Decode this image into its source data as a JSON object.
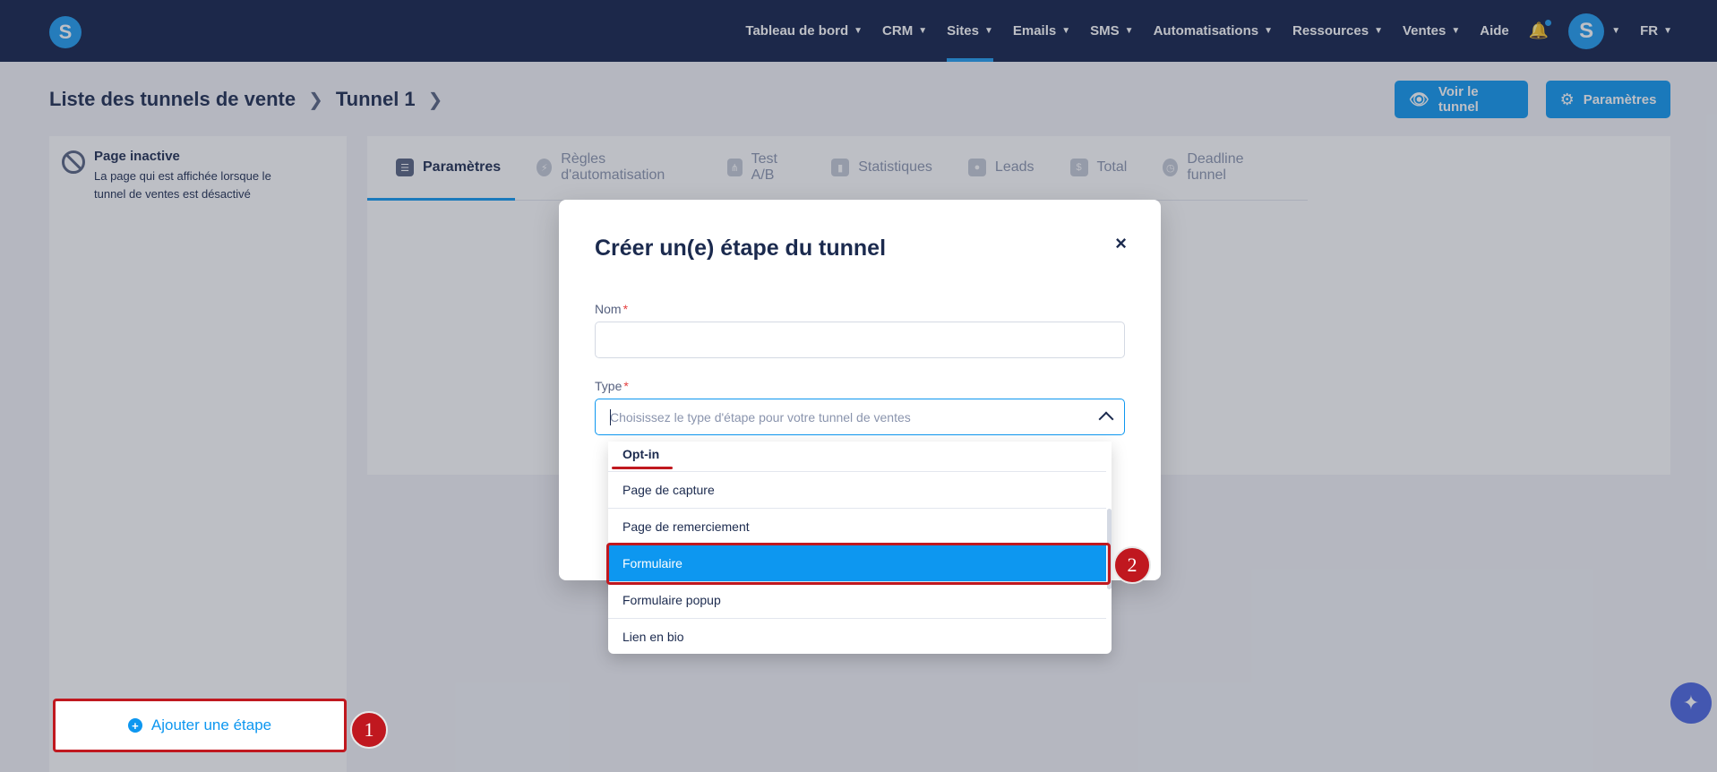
{
  "nav": {
    "logo_letter": "S",
    "items": [
      {
        "label": "Tableau de bord",
        "chevron": true
      },
      {
        "label": "CRM",
        "chevron": true
      },
      {
        "label": "Sites",
        "chevron": true,
        "active": true
      },
      {
        "label": "Emails",
        "chevron": true
      },
      {
        "label": "SMS",
        "chevron": true
      },
      {
        "label": "Automatisations",
        "chevron": true
      },
      {
        "label": "Ressources",
        "chevron": true
      },
      {
        "label": "Ventes",
        "chevron": true
      },
      {
        "label": "Aide",
        "chevron": false
      }
    ],
    "avatar_letter": "S",
    "language": "FR"
  },
  "breadcrumb": {
    "root": "Liste des tunnels de vente",
    "current": "Tunnel 1"
  },
  "header_buttons": {
    "view_funnel": "Voir le tunnel",
    "settings": "Paramètres"
  },
  "sidebar": {
    "step_title": "Page inactive",
    "step_description": "La page qui est affichée lorsque le tunnel de ventes est désactivé",
    "add_step_label": "Ajouter une étape"
  },
  "tabs": [
    {
      "label": "Paramètres",
      "active": true
    },
    {
      "label": "Règles d'automatisation"
    },
    {
      "label": "Test A/B"
    },
    {
      "label": "Statistiques"
    },
    {
      "label": "Leads"
    },
    {
      "label": "Total"
    },
    {
      "label": "Deadline funnel"
    }
  ],
  "modal": {
    "title": "Créer un(e) étape du tunnel",
    "close": "×",
    "name_label": "Nom",
    "name_value": "",
    "type_label": "Type",
    "type_placeholder": "Choisissez le type d'étape pour votre tunnel de ventes",
    "required_mark": "*"
  },
  "dropdown": {
    "group": "Opt-in",
    "options": [
      "Page de capture",
      "Page de remerciement",
      "Formulaire",
      "Formulaire popup",
      "Lien en bio"
    ],
    "selected": "Formulaire"
  },
  "markers": [
    "1",
    "2"
  ],
  "colors": {
    "navbar": "#0f1f48",
    "accent": "#0d97f0",
    "annotation": "#c0181f"
  }
}
